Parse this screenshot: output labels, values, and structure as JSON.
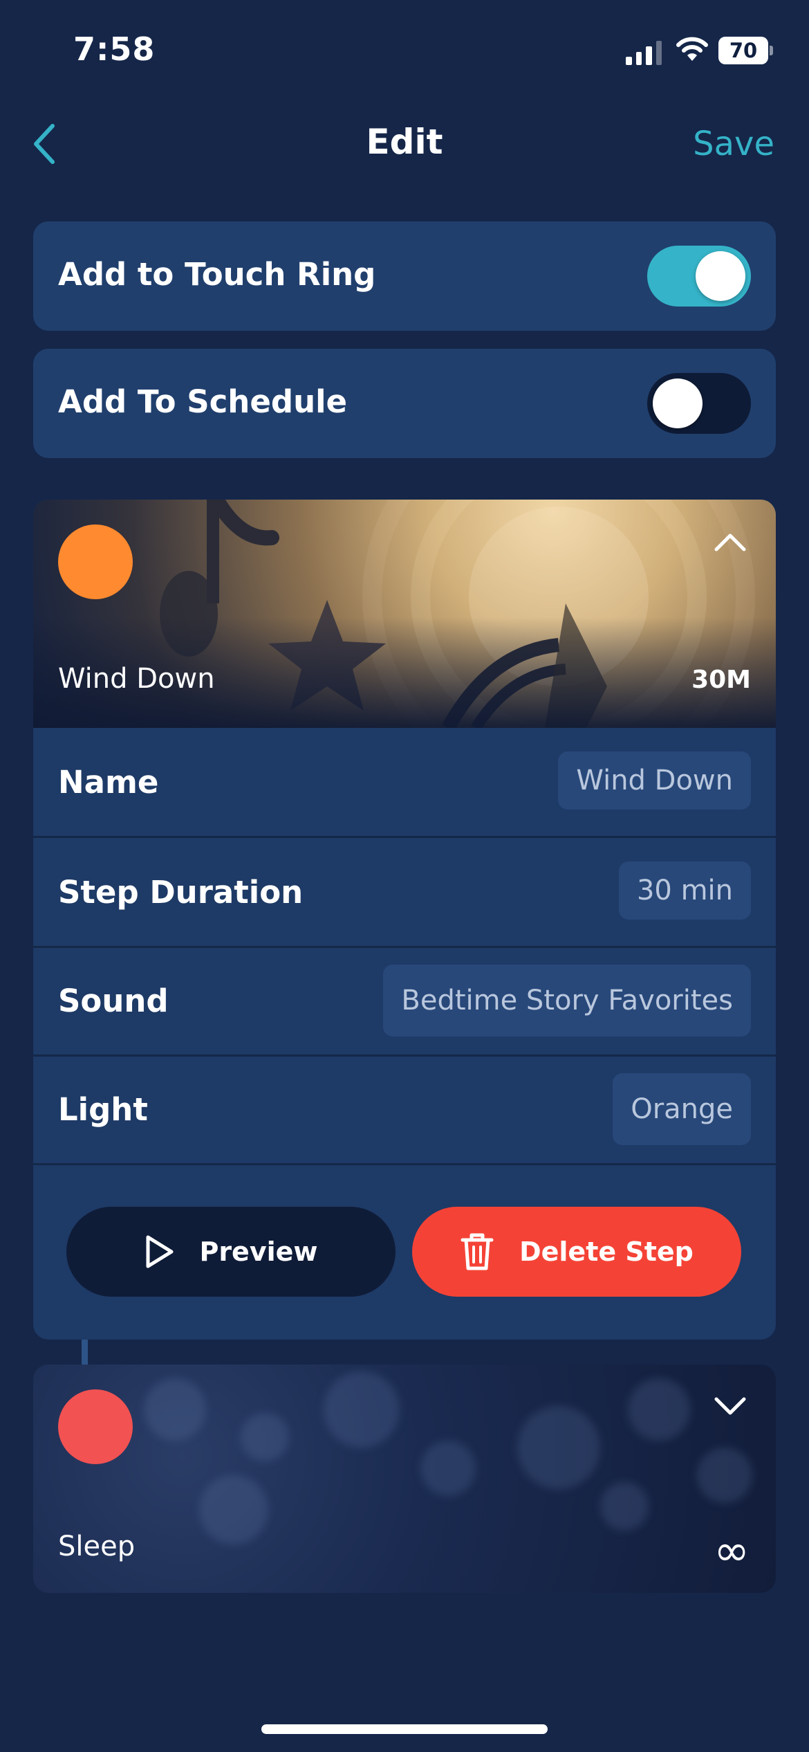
{
  "status_bar": {
    "time": "7:58",
    "battery": "70"
  },
  "nav": {
    "title": "Edit",
    "save_label": "Save",
    "back_icon": "chevron-left-icon"
  },
  "toggles": [
    {
      "label": "Add to Touch Ring",
      "on": true
    },
    {
      "label": "Add To Schedule",
      "on": false
    }
  ],
  "colors": {
    "accent": "#35b3c8",
    "delete": "#f44336",
    "step1_dot": "#ff8a2f",
    "step2_dot": "#f25252"
  },
  "step1": {
    "name": "Wind Down",
    "duration_badge": "30M",
    "expanded": true,
    "fields": [
      {
        "label": "Name",
        "value": "Wind Down"
      },
      {
        "label": "Step Duration",
        "value": "30 min"
      },
      {
        "label": "Sound",
        "value": "Bedtime Story Favorites"
      },
      {
        "label": "Light",
        "value": "Orange"
      }
    ],
    "preview_label": "Preview",
    "delete_label": "Delete Step"
  },
  "step2": {
    "name": "Sleep",
    "duration_symbol": "∞",
    "expanded": false
  }
}
